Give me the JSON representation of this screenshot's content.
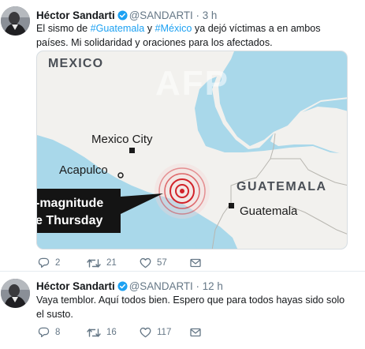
{
  "tweets": [
    {
      "author": {
        "name": "Héctor Sandarti",
        "handle": "@SANDARTI",
        "verified": true
      },
      "separator": "·",
      "time": "3 h",
      "text_parts": {
        "p1": "El sismo de ",
        "h1": "#Guatemala",
        "p2": " y ",
        "h2": "#México",
        "p3": " ya dejó víctimas a en ambos países. Mi solidaridad y oraciones para los afectados."
      },
      "media": {
        "watermark": "AFP",
        "labels": {
          "country_mexico": "MEXICO",
          "mexico_city": "Mexico City",
          "acapulco": "Acapulco",
          "country_guatemala": "GUATEMALA",
          "guatemala_city": "Guatemala",
          "callout_line1": "-magnitude",
          "callout_line2": "e Thursday"
        }
      },
      "actions": {
        "replies": "2",
        "retweets": "21",
        "likes": "57"
      }
    },
    {
      "author": {
        "name": "Héctor Sandarti",
        "handle": "@SANDARTI",
        "verified": true
      },
      "separator": "·",
      "time": "12 h",
      "text": "Vaya temblor. Aquí todos bien. Espero que para todos hayas sido solo el susto.",
      "actions": {
        "replies": "8",
        "retweets": "16",
        "likes": "117"
      }
    }
  ],
  "icons": {
    "reply": "reply-icon",
    "retweet": "retweet-icon",
    "like": "heart-icon",
    "message": "envelope-icon",
    "verified": "verified-badge-icon"
  },
  "colors": {
    "link": "#1da1f2",
    "secondary": "#657786",
    "map_land": "#f1f0ed",
    "map_sea": "#a9d8ea",
    "quake": "#d2232a"
  }
}
